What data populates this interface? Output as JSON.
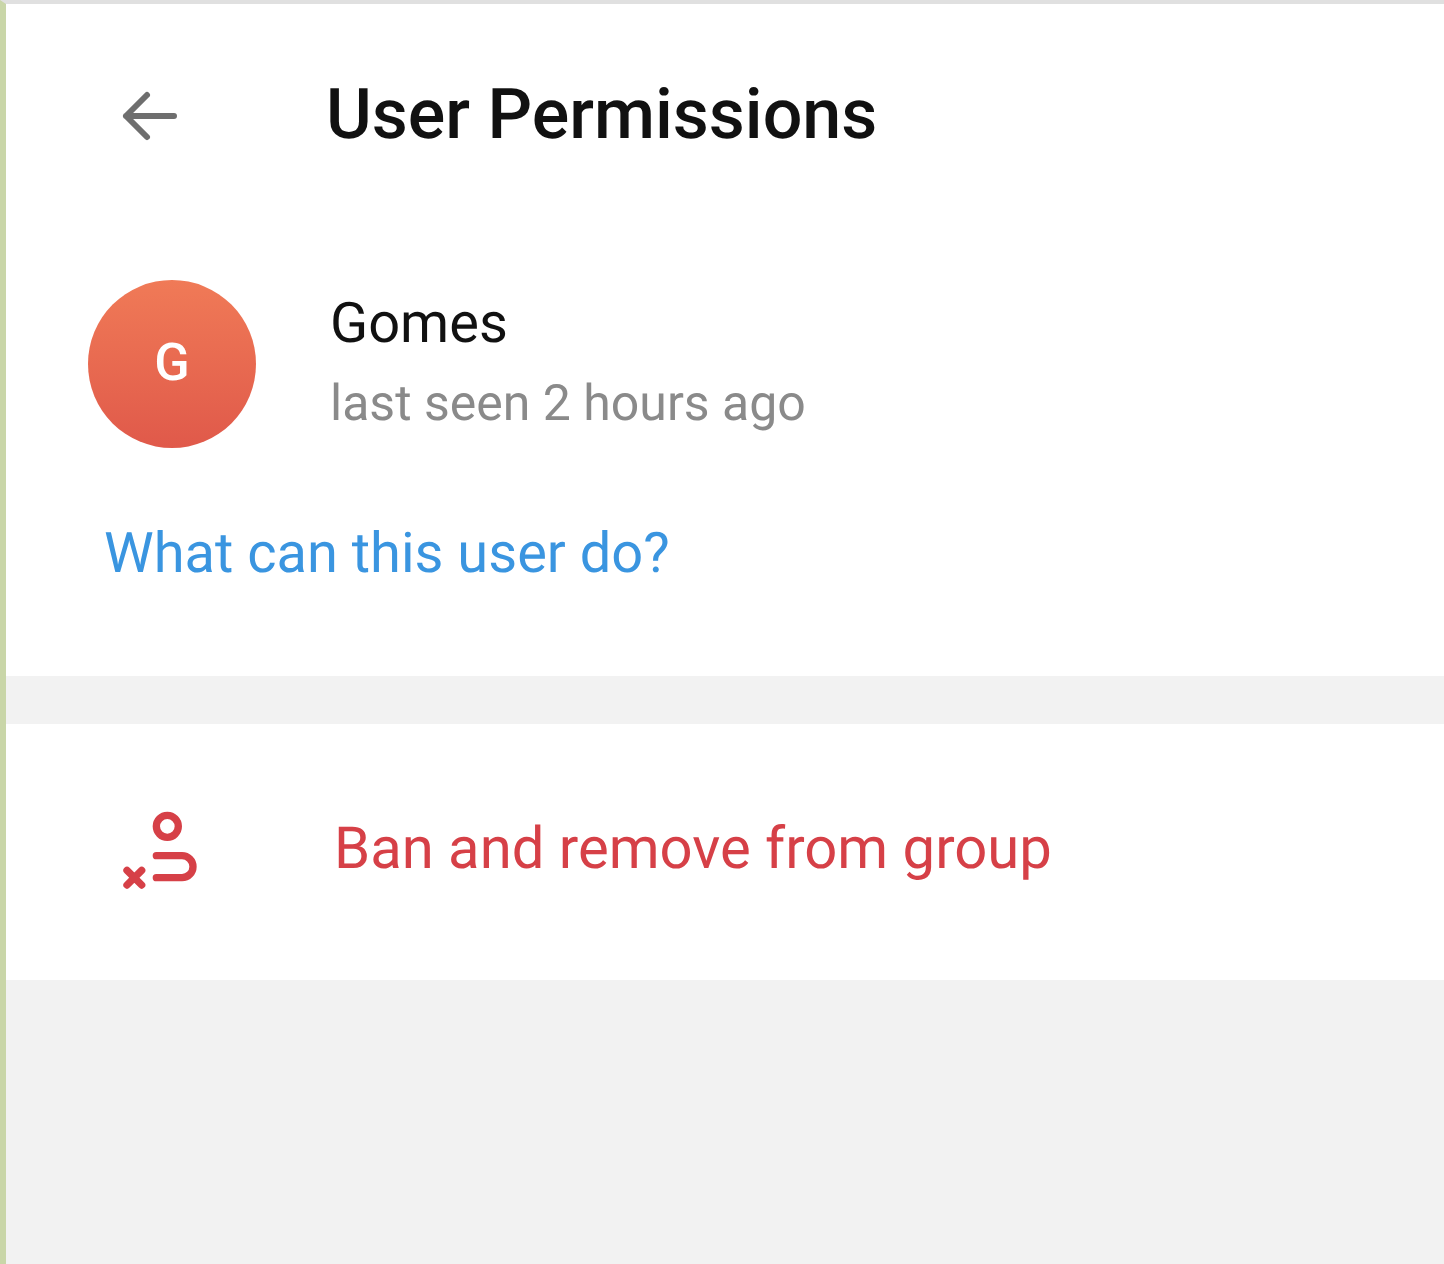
{
  "header": {
    "title": "User Permissions"
  },
  "user": {
    "initial": "G",
    "name": "Gomes",
    "status": "last seen 2 hours ago"
  },
  "permissions_link": "What can this user do?",
  "actions": [
    {
      "kind": "danger",
      "label": "Ban and remove from group"
    }
  ]
}
